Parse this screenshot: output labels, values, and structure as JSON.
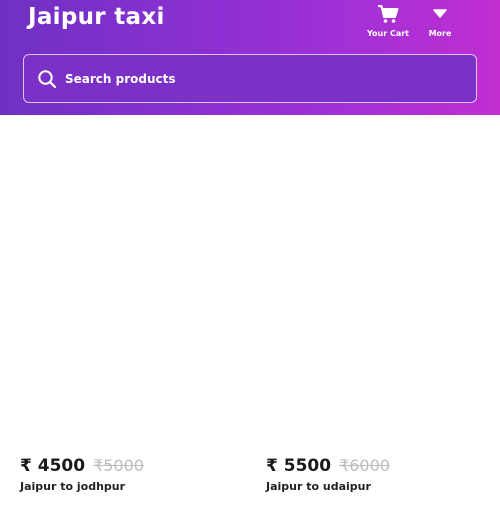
{
  "header": {
    "brand": "Jaipur taxi",
    "cart_label": "Your Cart",
    "more_label": "More"
  },
  "search": {
    "placeholder": "Search products"
  },
  "products": [
    {
      "price": "₹ 4500",
      "old_price": "₹5000",
      "title": "Jaipur to jodhpur"
    },
    {
      "price": "₹ 5500",
      "old_price": "₹6000",
      "title": "Jaipur to udaipur"
    }
  ],
  "colors": {
    "header_gradient_start": "#6f31c2",
    "header_gradient_end": "#c02ed0",
    "old_price": "#bdbdbd"
  },
  "icons": {
    "cart": "cart-icon",
    "more": "chevron-down-icon",
    "search": "search-icon"
  }
}
